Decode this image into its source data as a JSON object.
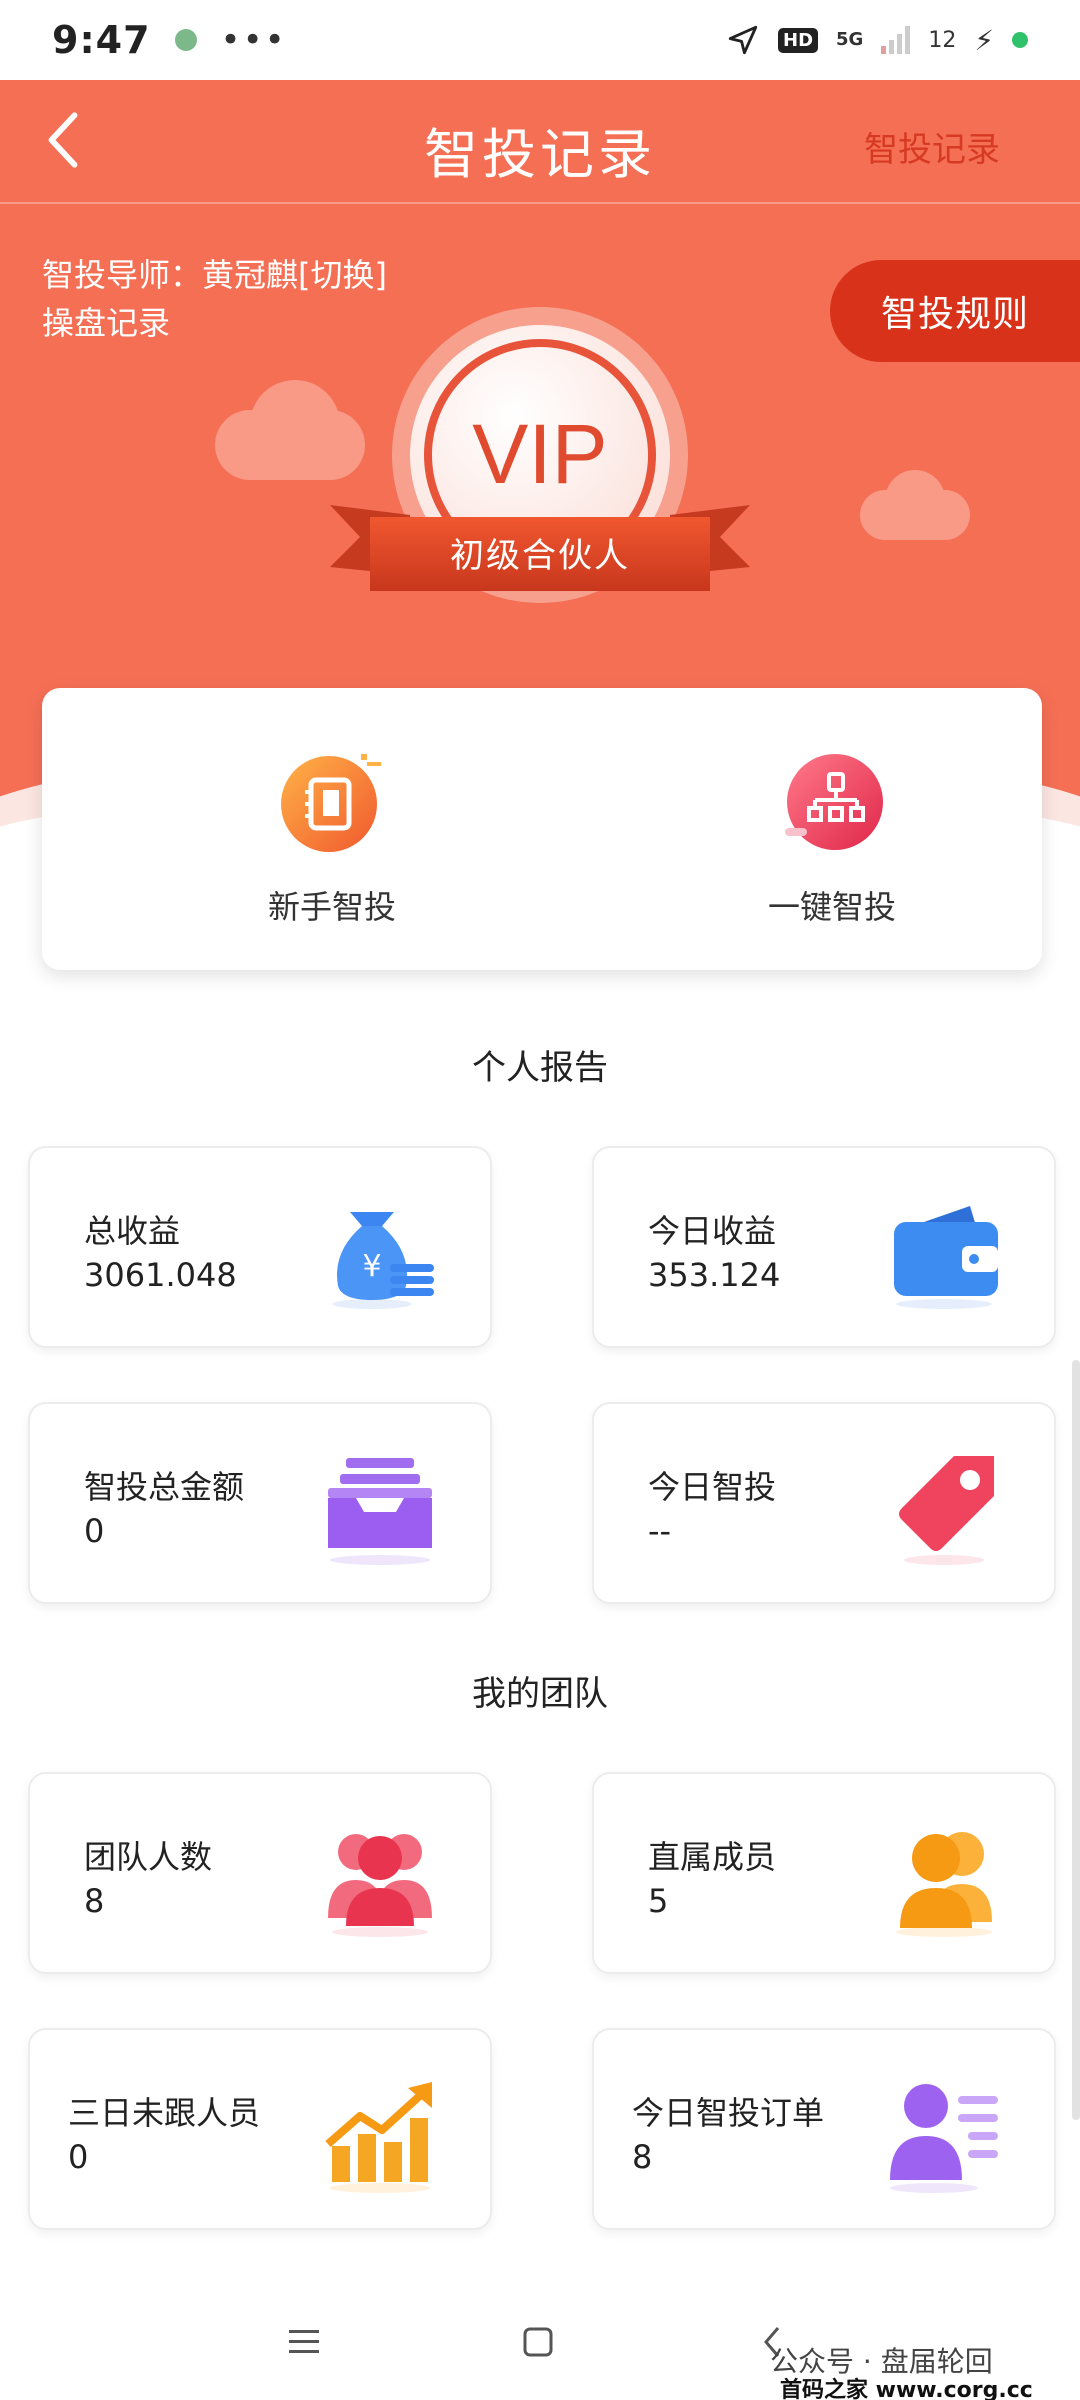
{
  "status_bar": {
    "time": "9:47",
    "dots": "•••",
    "hd": "HD",
    "network": "5G",
    "battery": "12",
    "bolt": "⚡"
  },
  "header": {
    "title": "智投记录",
    "right_link": "智投记录",
    "mentor_text": "智投导师：黄冠麒[切换]",
    "record_link": "操盘记录",
    "rules_button": "智投规则",
    "vip_text": "VIP",
    "vip_level": "初级合伙人"
  },
  "quick_actions": [
    {
      "label": "新手智投",
      "icon": "notebook-icon"
    },
    {
      "label": "一键智投",
      "icon": "org-chart-icon"
    }
  ],
  "personal_report": {
    "title": "个人报告",
    "cards": [
      {
        "label": "总收益",
        "value": "3061.048",
        "icon": "money-bag-icon"
      },
      {
        "label": "今日收益",
        "value": "353.124",
        "icon": "wallet-icon"
      },
      {
        "label": "智投总金额",
        "value": "0",
        "icon": "inbox-tray-icon"
      },
      {
        "label": "今日智投",
        "value": "--",
        "icon": "price-tag-icon"
      }
    ]
  },
  "team": {
    "title": "我的团队",
    "cards": [
      {
        "label": "团队人数",
        "value": "8",
        "icon": "team-people-icon"
      },
      {
        "label": "直属成员",
        "value": "5",
        "icon": "members-icon"
      },
      {
        "label": "三日未跟人员",
        "value": "0",
        "icon": "growth-chart-icon"
      },
      {
        "label": "今日智投订单",
        "value": "8",
        "icon": "user-list-icon"
      }
    ]
  },
  "watermark": {
    "line1": "公众号 · 盘届轮回",
    "line2": "首码之家 www.corg.cc"
  },
  "colors": {
    "header_bg": "#f56f55",
    "rules_button": "#d8321a",
    "right_link": "#d63a22"
  }
}
